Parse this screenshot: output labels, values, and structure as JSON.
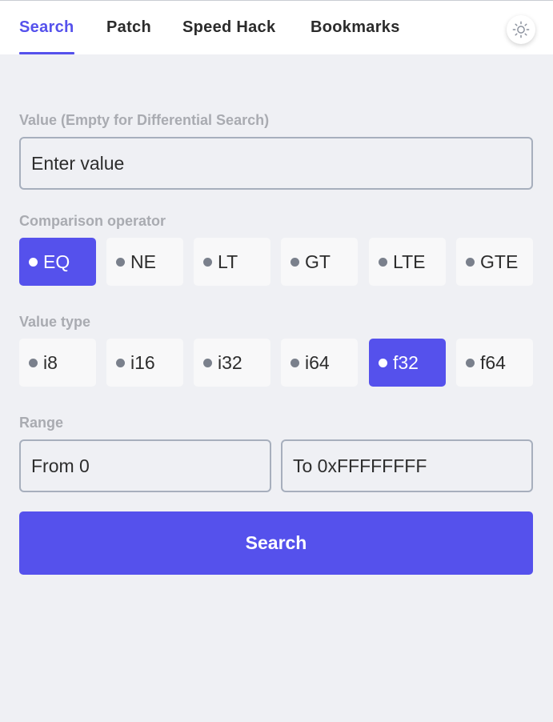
{
  "tabs": [
    {
      "label": "Search",
      "active": true
    },
    {
      "label": "Patch",
      "active": false
    },
    {
      "label": "Speed Hack",
      "active": false
    },
    {
      "label": "Bookmarks",
      "active": false
    }
  ],
  "theme_toggle": {
    "icon": "sun-icon"
  },
  "value_field": {
    "label": "Value (Empty for Differential Search)",
    "placeholder": "Enter value",
    "value": ""
  },
  "comparison": {
    "label": "Comparison operator",
    "options": [
      "EQ",
      "NE",
      "LT",
      "GT",
      "LTE",
      "GTE"
    ],
    "selected": "EQ"
  },
  "value_type": {
    "label": "Value type",
    "options": [
      "i8",
      "i16",
      "i32",
      "i64",
      "f32",
      "f64"
    ],
    "selected": "f32"
  },
  "range": {
    "label": "Range",
    "from_placeholder": "From 0",
    "to_placeholder": "To 0xFFFFFFFF"
  },
  "search_button": {
    "label": "Search"
  },
  "colors": {
    "accent": "#5551ec",
    "background": "#eff0f4",
    "label": "#a9abb1",
    "input_border": "#a7afbd"
  }
}
